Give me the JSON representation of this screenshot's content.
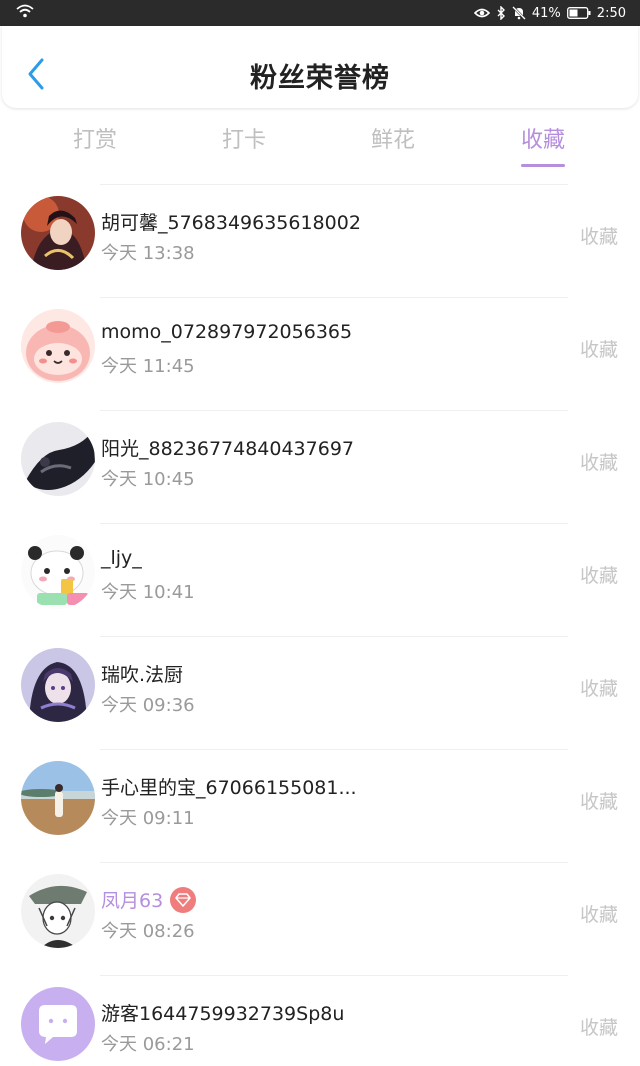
{
  "status_bar": {
    "battery": "41%",
    "time": "2:50",
    "icons": [
      "wifi-icon",
      "eye-icon",
      "bluetooth-icon",
      "mute-bell-icon",
      "battery-icon"
    ]
  },
  "header": {
    "title": "粉丝荣誉榜",
    "back_icon": "chevron-left-icon"
  },
  "tabs": [
    {
      "label": "打赏",
      "active": false
    },
    {
      "label": "打卡",
      "active": false
    },
    {
      "label": "鲜花",
      "active": false
    },
    {
      "label": "收藏",
      "active": true
    }
  ],
  "list": [
    {
      "name": "胡可馨_5768349635618002",
      "time": "今天 13:38",
      "action": "收藏",
      "vip": false
    },
    {
      "name": "momo_072897972056365",
      "time": "今天 11:45",
      "action": "收藏",
      "vip": false
    },
    {
      "name": "阳光_88236774840437697",
      "time": "今天 10:45",
      "action": "收藏",
      "vip": false
    },
    {
      "name": "_ljy_",
      "time": "今天 10:41",
      "action": "收藏",
      "vip": false
    },
    {
      "name": "瑞吹.法厨",
      "time": "今天 09:36",
      "action": "收藏",
      "vip": false
    },
    {
      "name": "手心里的宝_67066155081...",
      "time": "今天 09:11",
      "action": "收藏",
      "vip": false
    },
    {
      "name": "凤月63",
      "time": "今天 08:26",
      "action": "收藏",
      "vip": true
    },
    {
      "name": "游客1644759932739Sp8u",
      "time": "今天 06:21",
      "action": "收藏",
      "vip": false
    }
  ],
  "colors": {
    "accent": "#b58ede",
    "vip_badge": "#f07d7d",
    "muted": "#9a9a9a",
    "status_bar": "#2b2b2b",
    "back_arrow": "#2a9ce8"
  }
}
